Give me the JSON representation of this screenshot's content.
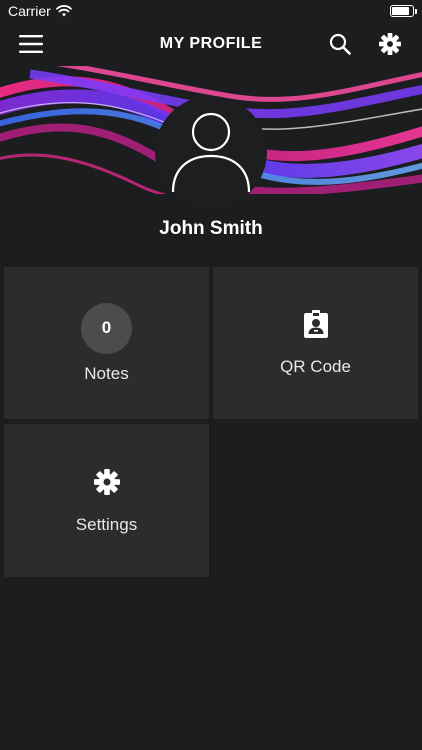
{
  "status_bar": {
    "carrier": "Carrier",
    "battery_level": 0.85
  },
  "nav": {
    "title": "MY PROFILE",
    "icons": [
      "menu-icon",
      "search-icon",
      "gear-icon"
    ]
  },
  "profile": {
    "name": "John Smith",
    "avatar_icon": "user-silhouette-icon"
  },
  "tiles": {
    "notes": {
      "count": "0",
      "label": "Notes"
    },
    "qr_code": {
      "label": "QR Code",
      "icon": "id-badge-icon"
    },
    "settings": {
      "label": "Settings",
      "icon": "gear-icon"
    }
  },
  "colors": {
    "background": "#1b1d1f",
    "tile": "#2a2c2e",
    "badge": "#4a4c4e",
    "accent_pink": "#e0288a",
    "accent_purple": "#7b2ff7"
  }
}
